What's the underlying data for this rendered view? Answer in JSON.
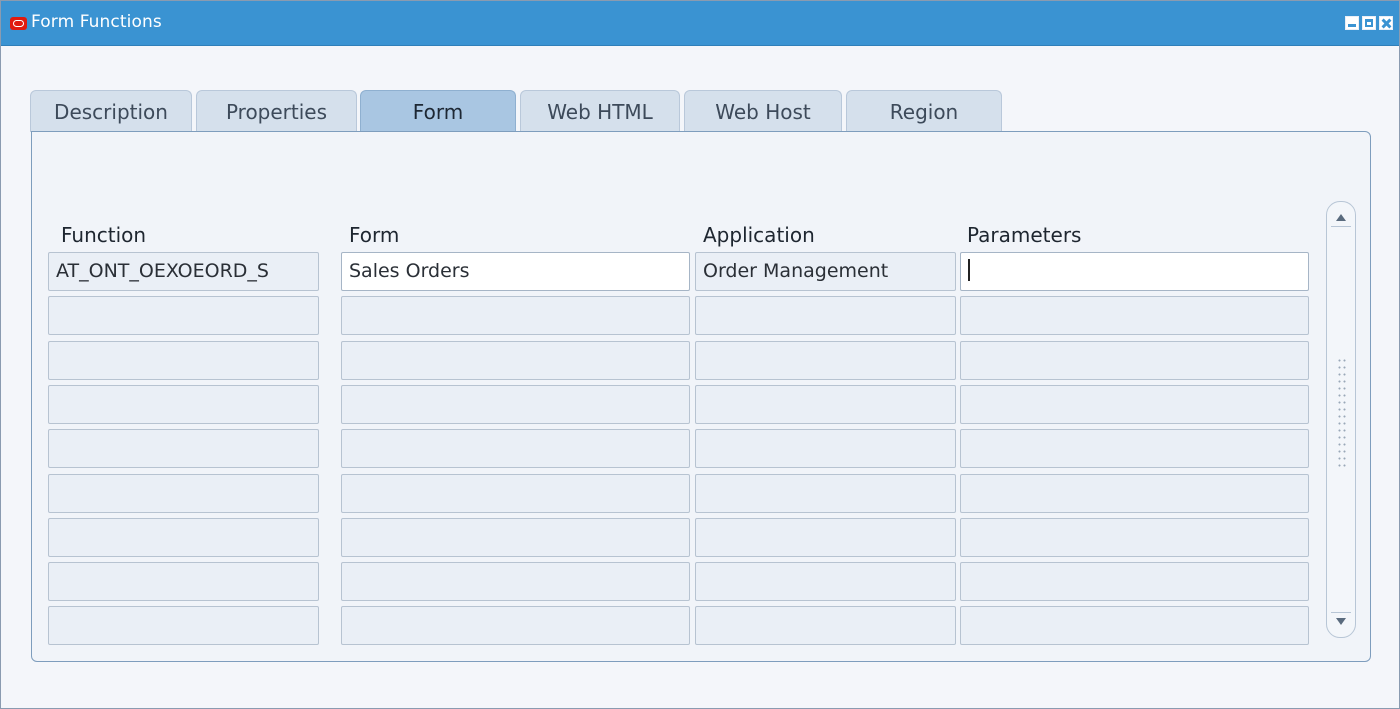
{
  "window": {
    "title": "Form Functions"
  },
  "tabs": [
    {
      "label": "Description",
      "active": false
    },
    {
      "label": "Properties",
      "active": false
    },
    {
      "label": "Form",
      "active": true
    },
    {
      "label": "Web HTML",
      "active": false
    },
    {
      "label": "Web Host",
      "active": false
    },
    {
      "label": "Region",
      "active": false
    }
  ],
  "grid": {
    "headers": {
      "function": "Function",
      "form": "Form",
      "application": "Application",
      "parameters": "Parameters"
    },
    "rows": [
      {
        "function": "AT_ONT_OEXOEORD_S",
        "form": "Sales Orders",
        "application": "Order Management",
        "parameters": ""
      },
      {
        "function": "",
        "form": "",
        "application": "",
        "parameters": ""
      },
      {
        "function": "",
        "form": "",
        "application": "",
        "parameters": ""
      },
      {
        "function": "",
        "form": "",
        "application": "",
        "parameters": ""
      },
      {
        "function": "",
        "form": "",
        "application": "",
        "parameters": ""
      },
      {
        "function": "",
        "form": "",
        "application": "",
        "parameters": ""
      },
      {
        "function": "",
        "form": "",
        "application": "",
        "parameters": ""
      },
      {
        "function": "",
        "form": "",
        "application": "",
        "parameters": ""
      },
      {
        "function": "",
        "form": "",
        "application": "",
        "parameters": ""
      }
    ]
  },
  "icons": {
    "app_logo": "oracle-logo-icon",
    "minimize": "minimize-icon",
    "maximize": "maximize-icon",
    "close": "close-icon",
    "scroll_up": "arrow-up-icon",
    "scroll_down": "arrow-down-icon"
  },
  "colors": {
    "titlebar": "#3a93d2",
    "active_tab": "#a9c6e2",
    "inactive_tab": "#d5e0ec",
    "logo": "#e11b0f"
  }
}
